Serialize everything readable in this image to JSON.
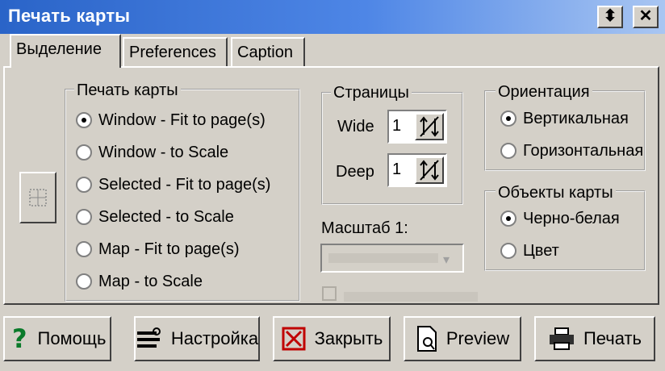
{
  "window": {
    "title": "Печать карты",
    "restore_glyph": "⬍",
    "close_glyph": "✕"
  },
  "tabs": [
    {
      "label": "Выделение",
      "active": true
    },
    {
      "label": "Preferences"
    },
    {
      "label": "Caption"
    }
  ],
  "print_group": {
    "legend": "Печать карты",
    "options": [
      {
        "label": "Window - Fit to page(s)",
        "checked": true
      },
      {
        "label": "Window - to Scale"
      },
      {
        "label": "Selected - Fit to page(s)"
      },
      {
        "label": "Selected - to Scale"
      },
      {
        "label": "Map - Fit to page(s)"
      },
      {
        "label": "Map - to Scale"
      }
    ]
  },
  "pages_group": {
    "legend": "Страницы",
    "wide_label": "Wide",
    "wide_value": "1",
    "deep_label": "Deep",
    "deep_value": "1"
  },
  "scale": {
    "label": "Масштаб 1:"
  },
  "orientation_group": {
    "legend": "Ориентация",
    "options": [
      {
        "label": "Вертикальная",
        "checked": true
      },
      {
        "label": "Горизонтальная"
      }
    ]
  },
  "objects_group": {
    "legend": "Объекты карты",
    "options": [
      {
        "label": "Черно-белая",
        "checked": true
      },
      {
        "label": "Цвет"
      }
    ]
  },
  "buttons": {
    "help": "Помощь",
    "settings": "Настройка",
    "close": "Закрыть",
    "preview": "Preview",
    "print": "Печать"
  },
  "colors": {
    "titlebar": "#2a64c8",
    "face": "#d4d0c8"
  }
}
